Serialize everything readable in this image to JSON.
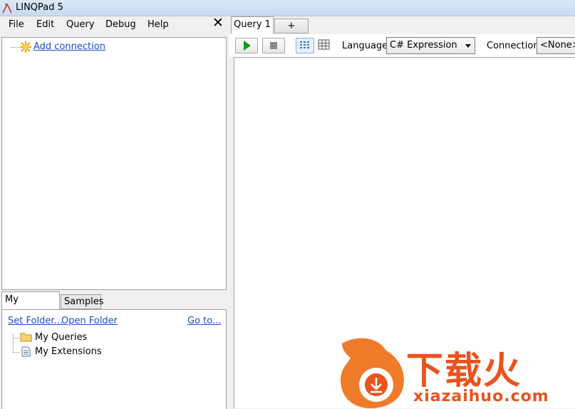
{
  "window": {
    "title": "LINQPad 5"
  },
  "menu": {
    "items": [
      "File",
      "Edit",
      "Query",
      "Debug",
      "Help"
    ],
    "close_glyph": "✕"
  },
  "connections": {
    "add_connection": "Add connection"
  },
  "query_tabs": [
    "My Queries",
    "Samples"
  ],
  "queries_panel": {
    "set_folder": "Set Folder...",
    "open_folder": "Open Folder",
    "go_to": "Go to...",
    "tree": [
      "My Queries",
      "My Extensions"
    ]
  },
  "editor_tabs": {
    "active": "Query 1",
    "new": "+"
  },
  "toolbar": {
    "language_label": "Language",
    "language_value": "C# Expression",
    "connection_label": "Connection",
    "connection_value": "<None>"
  },
  "watermark": {
    "cn": "下载火",
    "en": "xiazaihuo.com"
  },
  "colors": {
    "link": "#1a4dbd",
    "run_green": "#1a9a1a",
    "watermark": "#e8531e"
  },
  "icons": [
    "linqpad-lambda-icon",
    "star-icon",
    "folder-icon",
    "document-icon",
    "run-icon",
    "stop-icon",
    "rich-text-results-icon",
    "grid-results-icon"
  ]
}
